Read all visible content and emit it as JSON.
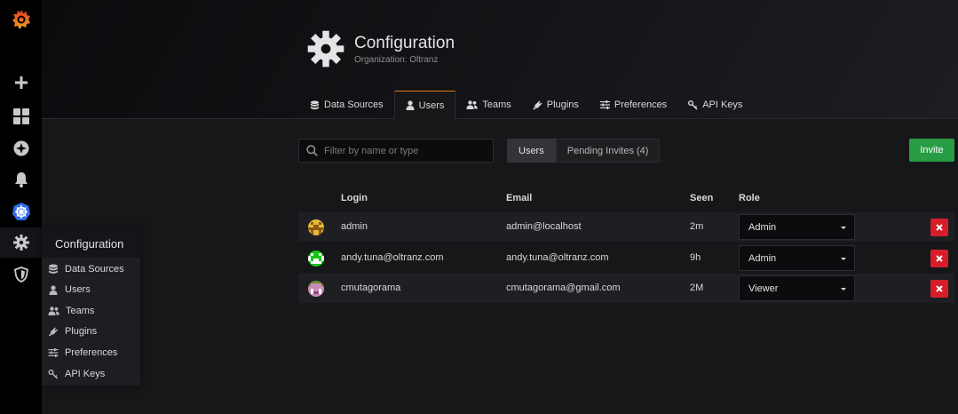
{
  "sidebar": {
    "items": [
      {
        "icon": "grafana-logo-icon"
      },
      {
        "icon": "plus-icon"
      },
      {
        "icon": "dashboards-icon"
      },
      {
        "icon": "explore-compass-icon"
      },
      {
        "icon": "bell-icon"
      },
      {
        "icon": "kubernetes-icon"
      },
      {
        "icon": "gear-icon"
      },
      {
        "icon": "shield-icon"
      }
    ]
  },
  "header": {
    "title": "Configuration",
    "subtitle": "Organization: Oltranz"
  },
  "tabs": [
    {
      "label": "Data Sources",
      "icon": "database-icon"
    },
    {
      "label": "Users",
      "icon": "user-icon",
      "active": true
    },
    {
      "label": "Teams",
      "icon": "team-icon"
    },
    {
      "label": "Plugins",
      "icon": "plug-icon"
    },
    {
      "label": "Preferences",
      "icon": "sliders-icon"
    },
    {
      "label": "API Keys",
      "icon": "key-icon"
    }
  ],
  "toolbar": {
    "filter_placeholder": "Filter by name or type",
    "users_button": "Users",
    "pending_button": "Pending Invites (4)",
    "invite_button": "Invite"
  },
  "table": {
    "columns": [
      "Login",
      "Email",
      "Seen",
      "Role"
    ],
    "rows": [
      {
        "login": "admin",
        "email": "admin@localhost",
        "seen": "2m",
        "role": "Admin",
        "avatar_color": "#8a6d1f"
      },
      {
        "login": "andy.tuna@oltranz.com",
        "email": "andy.tuna@oltranz.com",
        "seen": "9h",
        "role": "Admin",
        "avatar_color": "#1fc71f"
      },
      {
        "login": "cmutagorama",
        "email": "cmutagorama@gmail.com",
        "seen": "2M",
        "role": "Viewer",
        "avatar_color": "#b96fa1"
      }
    ]
  },
  "flyout": {
    "title": "Configuration",
    "items": [
      {
        "label": "Data Sources",
        "icon": "database-icon"
      },
      {
        "label": "Users",
        "icon": "user-icon"
      },
      {
        "label": "Teams",
        "icon": "team-icon"
      },
      {
        "label": "Plugins",
        "icon": "plug-icon"
      },
      {
        "label": "Preferences",
        "icon": "sliders-icon"
      },
      {
        "label": "API Keys",
        "icon": "key-icon"
      }
    ]
  },
  "colors": {
    "accent": "#eb7b18",
    "invite": "#299c46",
    "delete": "#d61e2a"
  }
}
